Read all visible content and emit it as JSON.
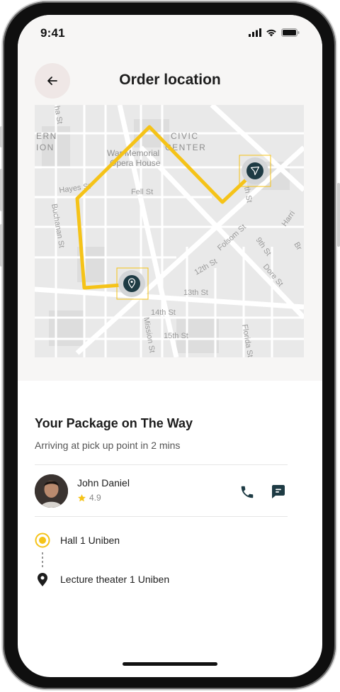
{
  "status_bar": {
    "time": "9:41"
  },
  "header": {
    "title": "Order location",
    "back_icon": "arrow-left-icon"
  },
  "map": {
    "street_labels": [
      "Hayes St",
      "Fell St",
      "Buchanan St",
      "Folsom St",
      "9th St",
      "12th St",
      "13th St",
      "14th St",
      "15th St",
      "Mission St",
      "Florida St",
      "Dore St",
      "Harri",
      "Br",
      "th St",
      "ha St"
    ],
    "poi_labels": [
      "War Memorial",
      "Opera House",
      "CIVIC",
      "CENTER",
      "ERN",
      "ION"
    ],
    "route_color": "#f5c318",
    "pickup_icon": "location-pin-icon",
    "driver_icon": "navigation-arrow-icon"
  },
  "package": {
    "title": "Your Package on The Way",
    "subtitle": "Arriving at pick up point in 2 mins"
  },
  "driver": {
    "name": "John Daniel",
    "rating": "4.9",
    "star_icon": "star-icon",
    "call_icon": "phone-icon",
    "message_icon": "message-icon"
  },
  "route": {
    "origin": "Hall 1 Uniben",
    "destination": "Lecture theater 1 Uniben"
  },
  "colors": {
    "accent": "#f5c318",
    "dark": "#1e3b44"
  }
}
